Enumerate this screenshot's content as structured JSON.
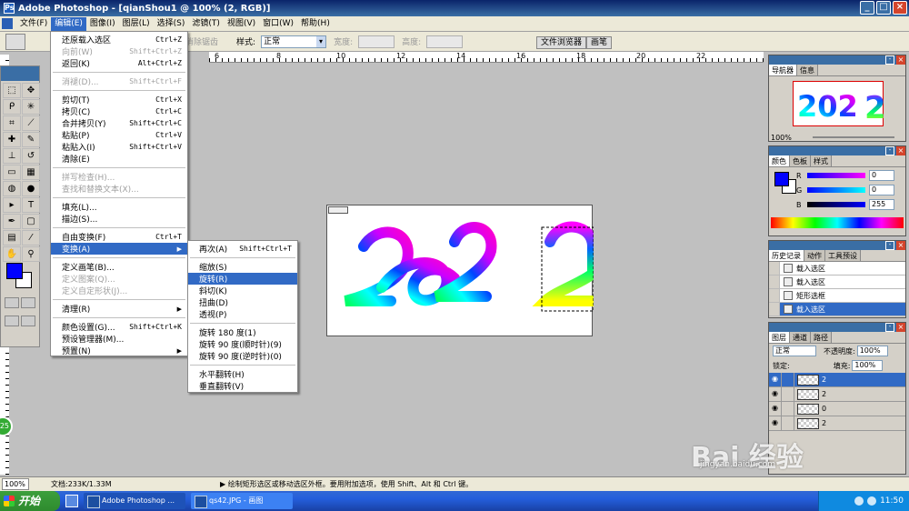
{
  "window": {
    "title": "Adobe Photoshop - [qianShou1 @ 100% (2, RGB)]"
  },
  "menubar": {
    "items": [
      "文件(F)",
      "编辑(E)",
      "图像(I)",
      "图层(L)",
      "选择(S)",
      "滤镜(T)",
      "视图(V)",
      "窗口(W)",
      "帮助(H)"
    ]
  },
  "options": {
    "style_label": "样式:",
    "style_value": "正常",
    "width_label": "宽度:",
    "height_label": "高度:",
    "anti_alias_label": "消除锯齿",
    "file_browser_tab": "文件浏览器",
    "brushes_tab": "画笔"
  },
  "edit_menu": {
    "items": [
      {
        "label": "还原载入选区",
        "shortcut": "Ctrl+Z",
        "disabled": false
      },
      {
        "label": "向前(W)",
        "shortcut": "Shift+Ctrl+Z",
        "disabled": true
      },
      {
        "label": "返回(K)",
        "shortcut": "Alt+Ctrl+Z",
        "disabled": false
      },
      {
        "label": "消褪(D)...",
        "shortcut": "Shift+Ctrl+F",
        "disabled": true
      },
      {
        "label": "剪切(T)",
        "shortcut": "Ctrl+X",
        "disabled": false
      },
      {
        "label": "拷贝(C)",
        "shortcut": "Ctrl+C",
        "disabled": false
      },
      {
        "label": "合并拷贝(Y)",
        "shortcut": "Shift+Ctrl+C",
        "disabled": false
      },
      {
        "label": "粘贴(P)",
        "shortcut": "Ctrl+V",
        "disabled": false
      },
      {
        "label": "粘贴入(I)",
        "shortcut": "Shift+Ctrl+V",
        "disabled": false
      },
      {
        "label": "清除(E)",
        "shortcut": "",
        "disabled": false
      },
      {
        "label": "拼写检查(H)...",
        "shortcut": "",
        "disabled": true
      },
      {
        "label": "查找和替换文本(X)...",
        "shortcut": "",
        "disabled": true
      },
      {
        "label": "填充(L)...",
        "shortcut": "",
        "disabled": false
      },
      {
        "label": "描边(S)...",
        "shortcut": "",
        "disabled": false
      },
      {
        "label": "自由变换(F)",
        "shortcut": "Ctrl+T",
        "disabled": false
      },
      {
        "label": "变换(A)",
        "shortcut": "",
        "disabled": false,
        "submenu": true
      },
      {
        "label": "定义画笔(B)...",
        "shortcut": "",
        "disabled": false
      },
      {
        "label": "定义图案(Q)...",
        "shortcut": "",
        "disabled": true
      },
      {
        "label": "定义自定形状(J)...",
        "shortcut": "",
        "disabled": true
      },
      {
        "label": "清理(R)",
        "shortcut": "",
        "disabled": false,
        "submenu": true
      },
      {
        "label": "颜色设置(G)...",
        "shortcut": "Shift+Ctrl+K",
        "disabled": false
      },
      {
        "label": "预设管理器(M)...",
        "shortcut": "",
        "disabled": false
      },
      {
        "label": "预置(N)",
        "shortcut": "",
        "disabled": false,
        "submenu": true
      }
    ]
  },
  "transform_menu": {
    "items": [
      {
        "label": "再次(A)",
        "shortcut": "Shift+Ctrl+T"
      },
      {
        "label": "缩放(S)",
        "shortcut": ""
      },
      {
        "label": "旋转(R)",
        "shortcut": ""
      },
      {
        "label": "斜切(K)",
        "shortcut": ""
      },
      {
        "label": "扭曲(D)",
        "shortcut": ""
      },
      {
        "label": "透视(P)",
        "shortcut": ""
      },
      {
        "label": "旋转 180 度(1)",
        "shortcut": ""
      },
      {
        "label": "旋转 90 度(顺时针)(9)",
        "shortcut": ""
      },
      {
        "label": "旋转 90 度(逆时针)(0)",
        "shortcut": ""
      },
      {
        "label": "水平翻转(H)",
        "shortcut": ""
      },
      {
        "label": "垂直翻转(V)",
        "shortcut": ""
      }
    ]
  },
  "ruler": {
    "ticks": [
      "6",
      "8",
      "10",
      "12",
      "14",
      "16",
      "18",
      "20",
      "22"
    ]
  },
  "document": {
    "text_left": "202",
    "text_right": "2"
  },
  "navigator": {
    "tabs": [
      "导航器",
      "信息"
    ],
    "zoom": "100%"
  },
  "color_panel": {
    "tabs": [
      "颜色",
      "色板",
      "样式"
    ],
    "r_label": "R",
    "g_label": "G",
    "b_label": "B",
    "r_value": "0",
    "g_value": "0",
    "b_value": "255",
    "fg_color": "#0000ff"
  },
  "history": {
    "tabs": [
      "历史记录",
      "动作",
      "工具预设"
    ],
    "items": [
      "载入选区",
      "载入选区",
      "矩形选框",
      "载入选区"
    ],
    "selected_index": 3
  },
  "layers": {
    "tabs": [
      "图层",
      "通道",
      "路径"
    ],
    "blend_mode": "正常",
    "opacity_label": "不透明度:",
    "opacity": "100%",
    "lock_label": "锁定:",
    "fill_label": "填充:",
    "fill": "100%",
    "items": [
      "2",
      "2",
      "0",
      "2"
    ],
    "selected_index": 0
  },
  "status": {
    "zoom": "100%",
    "doc_info": "文档:233K/1.33M",
    "hint": "▶ 绘制矩形选区或移动选区外框。要用附加选项，使用 Shift、Alt 和 Ctrl 键。"
  },
  "taskbar": {
    "start": "开始",
    "tasks": [
      "Adobe Photoshop ...",
      "qs42.JPG - 画图"
    ],
    "time": "11:50"
  },
  "watermark": {
    "main": "Bai 经验",
    "sub": "jingyan.baidu.com"
  },
  "badge": "25"
}
